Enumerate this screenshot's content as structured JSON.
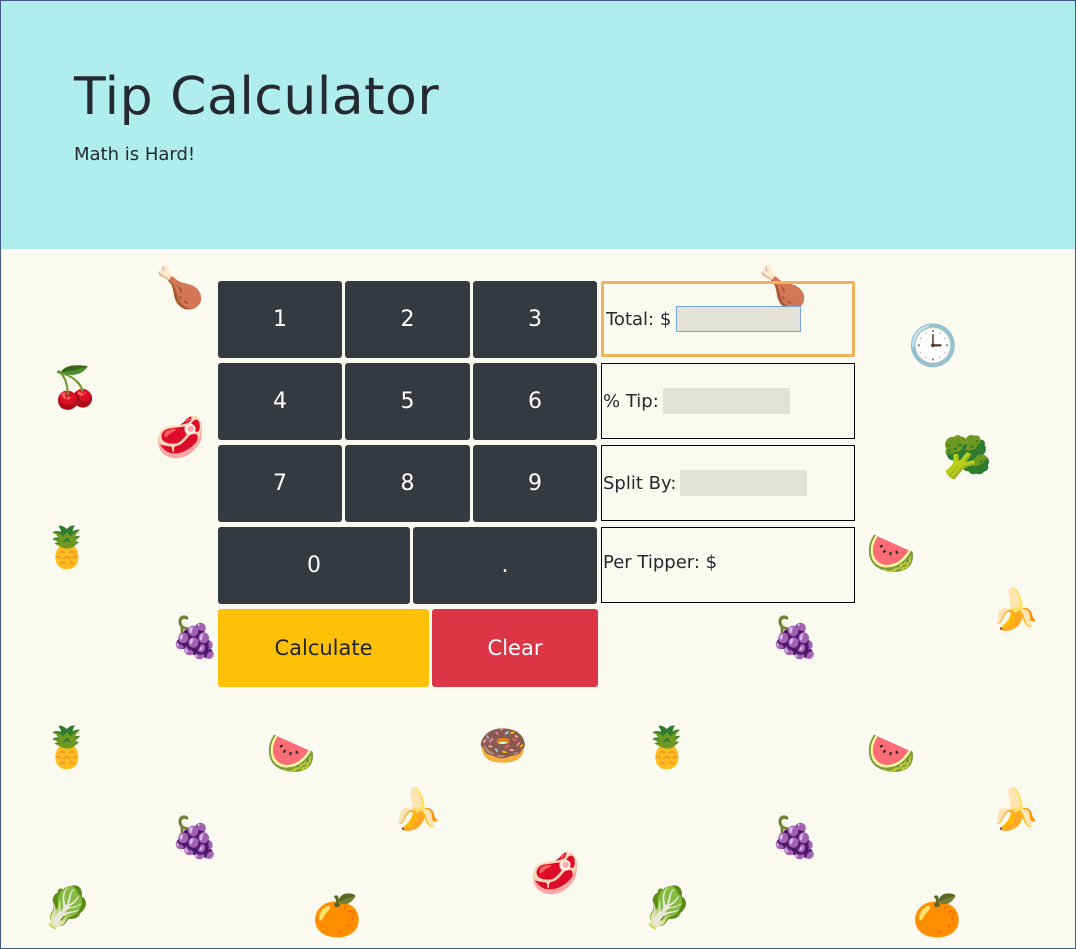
{
  "header": {
    "title": "Tip Calculator",
    "subtitle": "Math is Hard!"
  },
  "keypad": {
    "keys": [
      "1",
      "2",
      "3",
      "4",
      "5",
      "6",
      "7",
      "8",
      "9",
      "0",
      "."
    ],
    "calculate_label": "Calculate",
    "clear_label": "Clear"
  },
  "fields": {
    "total_label": "Total: $",
    "total_value": "",
    "tip_label": "% Tip:",
    "tip_value": "",
    "split_label": "Split By:",
    "split_value": "",
    "per_tipper_label": "Per Tipper: $",
    "per_tipper_value": ""
  },
  "colors": {
    "header_bg": "#b0eeee",
    "page_bg": "#fafaf0",
    "key_bg": "#343a40",
    "calculate_bg": "#ffc107",
    "clear_bg": "#dc3545",
    "active_border": "#f0b25a"
  }
}
